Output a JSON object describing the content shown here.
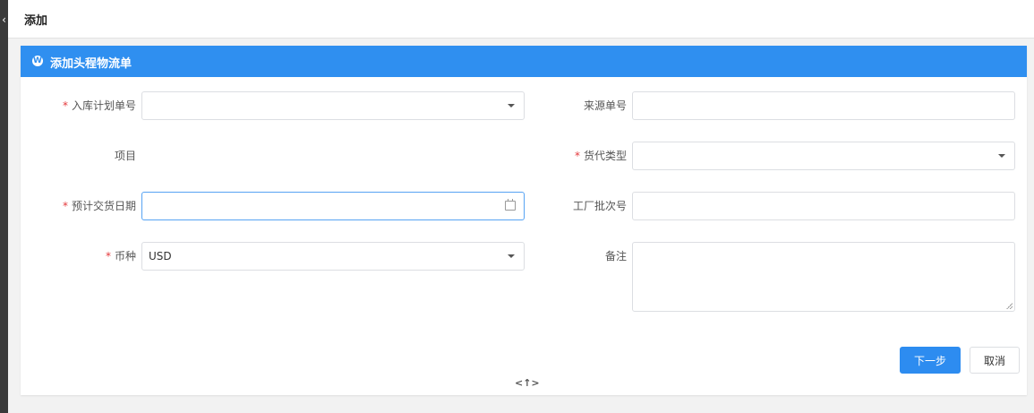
{
  "window": {
    "title": "添加"
  },
  "panel": {
    "title": "添加头程物流单",
    "header_icon": "wordpress-icon",
    "accent": "#2f8ff0"
  },
  "form": {
    "inbound_plan_no": {
      "label": "入库计划单号",
      "required": true,
      "value": ""
    },
    "project": {
      "label": "项目",
      "required": false
    },
    "expected_delivery_date": {
      "label": "预计交货日期",
      "required": true,
      "value": ""
    },
    "currency": {
      "label": "币种",
      "required": true,
      "value": "USD"
    },
    "source_no": {
      "label": "来源单号",
      "required": false,
      "value": ""
    },
    "forwarder_type": {
      "label": "货代类型",
      "required": true,
      "value": ""
    },
    "factory_batch_no": {
      "label": "工厂批次号",
      "required": false,
      "value": ""
    },
    "remark": {
      "label": "备注",
      "required": false,
      "value": ""
    }
  },
  "actions": {
    "next_label": "下一步",
    "cancel_label": "取消"
  },
  "toggle_glyph": "<↑>"
}
